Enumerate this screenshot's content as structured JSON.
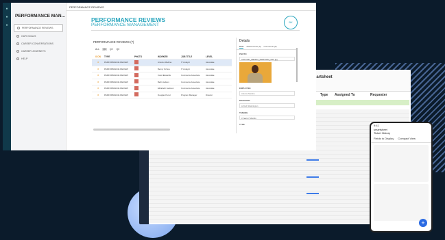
{
  "spreadsheet": {
    "brand": "Smartsheet",
    "columns": [
      "Type",
      "Assigned To",
      "Requester"
    ],
    "mobile": {
      "time": "9:41",
      "title": "smartsheet",
      "subtitle": "Ticket History",
      "fields_label": "Fields to Display",
      "view_label": "Compact View"
    }
  },
  "app": {
    "sidebar_title": "PERFORMANCE MAN...",
    "topbar_title": "PERFORMANCE REVIEWS",
    "nav": [
      {
        "label": "PERFORMANCE REVIEWS",
        "active": true
      },
      {
        "label": "OUR GOALS",
        "active": false
      },
      {
        "label": "CAREER CONVERSATIONS",
        "active": false
      },
      {
        "label": "CAREER JOURNEYS",
        "active": false
      },
      {
        "label": "HELP",
        "active": false
      }
    ],
    "page_title": "PERFORMANCE REVIEWS",
    "page_subtitle": "PERFORMANCE MANAGEMENT",
    "logo_text": "BK"
  },
  "list": {
    "title": "PERFORMANCE REVIEWS (7)",
    "filters": [
      "ALL",
      "Q1",
      "Q2",
      "Q3"
    ],
    "headers": [
      "ICON",
      "TYPE",
      "PHOTO",
      "WORKER",
      "JOB TITLE",
      "LEVEL"
    ],
    "rows": [
      {
        "type": "PERFORMANCE REVIEW",
        "worker": "Antonio Medina",
        "job": "IT Analyst",
        "level": "Associate"
      },
      {
        "type": "PERFORMANCE REVIEW",
        "worker": "Benny Ochoa",
        "job": "IT Analyst",
        "level": "Associate"
      },
      {
        "type": "PERFORMANCE REVIEW",
        "worker": "Carol Edwards",
        "job": "Commerce Associate",
        "level": "Associate"
      },
      {
        "type": "PERFORMANCE REVIEW",
        "worker": "Beth Hudson",
        "job": "Commerce Associate",
        "level": "Associate"
      },
      {
        "type": "PERFORMANCE REVIEW",
        "worker": "Elizabeth Jackson",
        "job": "Commerce Associate",
        "level": "Associate"
      },
      {
        "type": "PERFORMANCE REVIEW",
        "worker": "Douglas Perez",
        "job": "Program Manager",
        "level": "Director"
      }
    ]
  },
  "details": {
    "title": "Details",
    "tabs": [
      "Data",
      "Attachments (0)",
      "Comments (0)"
    ],
    "photo_label": "PHOTO",
    "photo_file": "ANTONIO_MEDINA_PERFORM_ANC.jpg",
    "employee_label": "EMPLOYEE",
    "employee_value": "Antonio Medina",
    "manager_label": "MANAGER",
    "manager_value": "Lizbeth Washington",
    "tenure_label": "TENURE",
    "tenure_value": "3 Years 7 Months",
    "type_label": "TYPE"
  }
}
